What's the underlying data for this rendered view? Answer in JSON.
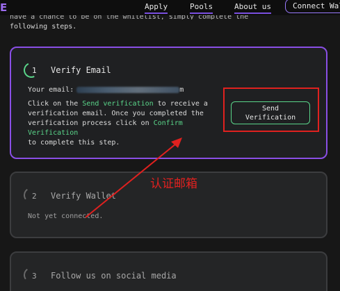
{
  "nav": {
    "logo": "E",
    "links": [
      "Apply",
      "Pools",
      "About us"
    ],
    "connect_label": "Connect Wal"
  },
  "intro": {
    "line1_partial": "have a chance to be on the whitelist, simply complete the",
    "line2": "following steps."
  },
  "steps": [
    {
      "number": "1",
      "title": "Verify Email",
      "email_label": "Your email:",
      "email_value_visible_suffix": "m",
      "text_a": "Click on the ",
      "text_link1": "Send verification",
      "text_b": " to receive a",
      "text_c": "verification email. Once you completed the",
      "text_d": "verification process click on ",
      "text_link2": "Confirm Verification",
      "text_e": "to complete this step.",
      "button_line1": "Send",
      "button_line2": "Verification"
    },
    {
      "number": "2",
      "title": "Verify Wallet",
      "status": "Not yet connected."
    },
    {
      "number": "3",
      "title": "Follow us on social media"
    }
  ],
  "annotation": {
    "label": "认证邮箱",
    "color": "#e0211f"
  },
  "colors": {
    "accent_purple": "#8a4fe6",
    "accent_green": "#5ad68a",
    "background": "#171717"
  }
}
